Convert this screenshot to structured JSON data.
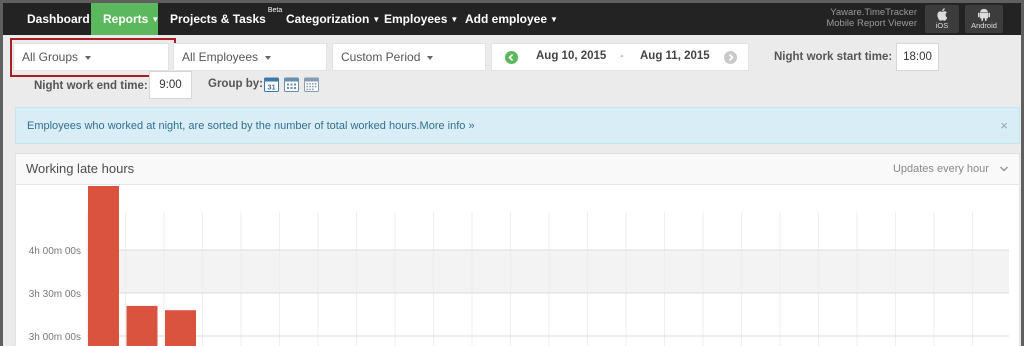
{
  "nav": {
    "items": [
      {
        "label": "Dashboard",
        "caret": ""
      },
      {
        "label": "Reports",
        "caret": "⌄"
      },
      {
        "label": "Projects & Tasks",
        "caret": "",
        "sup": "Beta"
      },
      {
        "label": "Categorization",
        "caret": "⌄"
      },
      {
        "label": "Employees",
        "caret": "⌄"
      },
      {
        "label": "Add employee",
        "caret": "⌄"
      }
    ],
    "mobile_title_line1": "Yaware.TimeTracker",
    "mobile_title_line2": "Mobile Report Viewer",
    "ios_label": "iOS",
    "android_label": "Android",
    "active_color": "#5cb85c"
  },
  "filters": {
    "groups": "All Groups",
    "employees": "All Employees",
    "period": "Custom Period",
    "date_from": "Aug 10, 2015",
    "date_sep": "-",
    "date_to": "Aug 11, 2015",
    "night_start_label": "Night work start time:",
    "night_start_value": "18:00",
    "night_end_label": "Night work end time:",
    "night_end_value": "9:00",
    "group_by_label": "Group by:",
    "group_by_day_number": "31"
  },
  "info": {
    "text": "Employees who worked at night, are sorted by the number of total worked hours.",
    "link": "More info »",
    "close": "×"
  },
  "panel": {
    "title": "Working late hours",
    "updates": "Updates every hour"
  },
  "chart_data": {
    "type": "bar",
    "bar_color": "#d9533f",
    "values_seconds": [
      17100,
      12060,
      11880
    ],
    "y_ticks": [
      {
        "label": "4h 00m 00s",
        "seconds": 14400
      },
      {
        "label": "3h 30m 00s",
        "seconds": 12600
      },
      {
        "label": "3h 00m 00s",
        "seconds": 10800
      }
    ]
  }
}
